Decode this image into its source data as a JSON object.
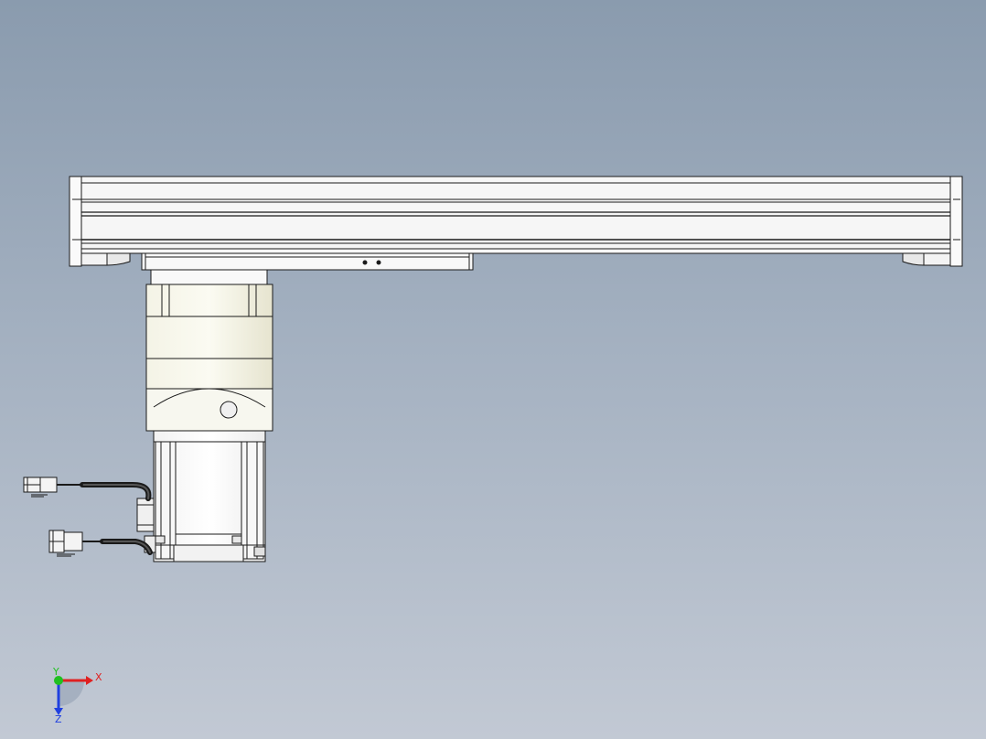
{
  "viewport": {
    "background_top": "#8a9bae",
    "background_bottom": "#c2c9d4"
  },
  "model": {
    "line_color": "#1a1a1a",
    "rail_color": "#f6f6f6",
    "body_color": "#ffffff",
    "gearhead_color": "#efeedd",
    "cable_color": "#2a2a2a"
  },
  "triad": {
    "x_label": "X",
    "y_label": "Y",
    "z_label": "Z",
    "x_color": "#e02020",
    "y_color": "#20c020",
    "z_color": "#2040e0"
  }
}
